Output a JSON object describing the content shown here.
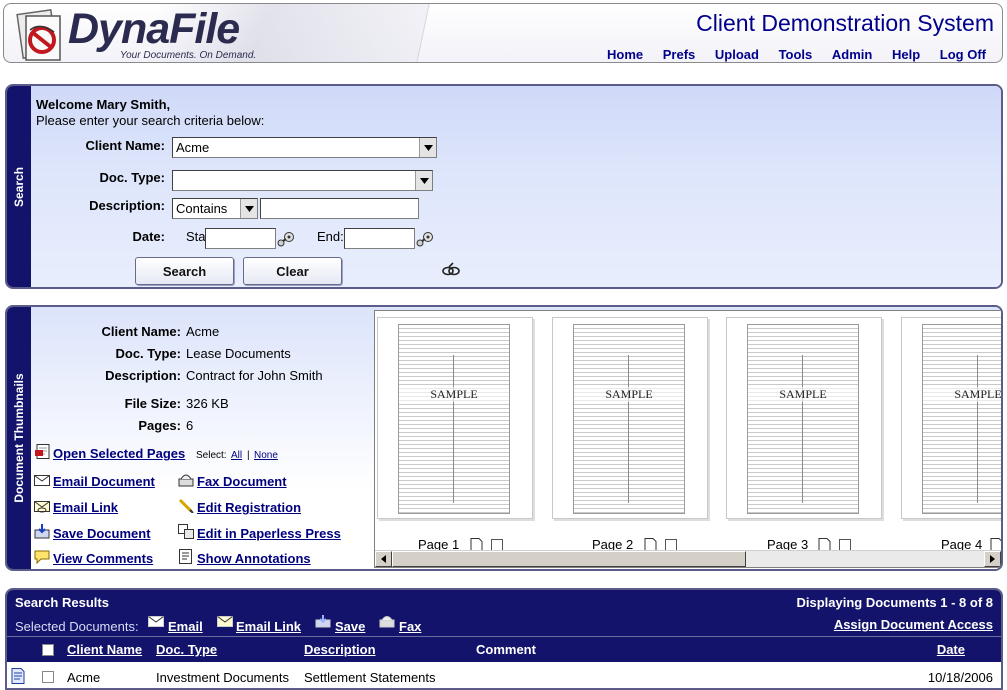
{
  "brand": {
    "logo_text": "DynaFile",
    "tagline": "Your Documents. On Demand.",
    "app_title": "Client Demonstration System"
  },
  "nav": [
    "Home",
    "Prefs",
    "Upload",
    "Tools",
    "Admin",
    "Help",
    "Log Off"
  ],
  "search": {
    "tab_label": "Search",
    "welcome": "Welcome Mary Smith,",
    "instructions": "Please enter your search criteria below:",
    "client_name_label": "Client Name:",
    "client_name_value": "Acme",
    "doc_type_label": "Doc. Type:",
    "doc_type_value": "",
    "description_label": "Description:",
    "description_operator": "Contains",
    "description_value": "",
    "date_label": "Date:",
    "start_label": "Start:",
    "end_label": "End:",
    "start_value": "",
    "end_value": "",
    "search_button": "Search",
    "clear_button": "Clear"
  },
  "thumbnails": {
    "tab_label": "Document Thumbnails",
    "details": {
      "client_name_label": "Client Name:",
      "client_name": "Acme",
      "doc_type_label": "Doc. Type:",
      "doc_type": "Lease Documents",
      "description_label": "Description:",
      "description": "Contract for John Smith",
      "file_size_label": "File Size:",
      "file_size": "326 KB",
      "pages_label": "Pages:",
      "pages": "6"
    },
    "open_selected": "Open Selected Pages",
    "select_label": "Select:",
    "select_all": "All",
    "select_separator": "|",
    "select_none": "None",
    "actions": {
      "email_document": "Email Document",
      "fax_document": "Fax Document",
      "email_link": "Email Link",
      "edit_registration": "Edit Registration",
      "save_document": "Save Document",
      "edit_in_paperless_press": "Edit in Paperless Press",
      "view_comments": "View Comments",
      "show_annotations": "Show Annotations"
    },
    "pages_list": [
      {
        "label": "Page 1",
        "watermark": "SAMPLE"
      },
      {
        "label": "Page 2",
        "watermark": "SAMPLE"
      },
      {
        "label": "Page 3",
        "watermark": "SAMPLE"
      },
      {
        "label": "Page 4",
        "watermark": "SAMPLE"
      }
    ]
  },
  "results": {
    "title": "Search Results",
    "displaying": "Displaying Documents 1 - 8 of 8",
    "selected_label": "Selected Documents:",
    "email": "Email",
    "email_link": "Email Link",
    "save": "Save",
    "fax": "Fax",
    "assign_access": "Assign Document Access",
    "columns": {
      "client_name": "Client Name",
      "doc_type": "Doc. Type",
      "description": "Description",
      "comment": "Comment",
      "date": "Date"
    },
    "rows": [
      {
        "client_name": "Acme",
        "doc_type": "Investment Documents",
        "description": "Settlement Statements",
        "comment": "",
        "date": "10/18/2006"
      }
    ]
  },
  "colors": {
    "navy": "#13136b",
    "link": "#00007f",
    "search_bg": "#dde5fb"
  }
}
